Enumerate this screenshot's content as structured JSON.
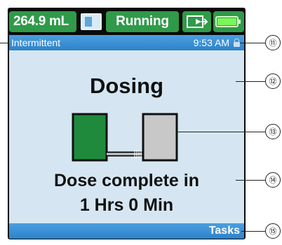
{
  "topbar": {
    "volume": "264.9 mL",
    "status": "Running",
    "icons": {
      "panel": "panel-icon",
      "transfer": "transfer-icon",
      "battery": "battery-icon"
    },
    "battery_level": 1.0
  },
  "infobar": {
    "mode": "Intermittent",
    "time": "9:53 AM",
    "icon": "lock-icon"
  },
  "main": {
    "title": "Dosing",
    "message_line1": "Dose complete in",
    "message_line2": "1 Hrs 0 Min"
  },
  "bottombar": {
    "tasks_label": "Tasks"
  },
  "callouts": [
    "⑪",
    "⑫",
    "⑬",
    "⑭",
    "⑮"
  ],
  "colors": {
    "status_green": "#2f9a49",
    "info_blue": "#3a90d6",
    "screen_bg": "#d5e6f2",
    "dose_filled": "#1f8a3c",
    "dose_empty": "#c8c8c8"
  }
}
